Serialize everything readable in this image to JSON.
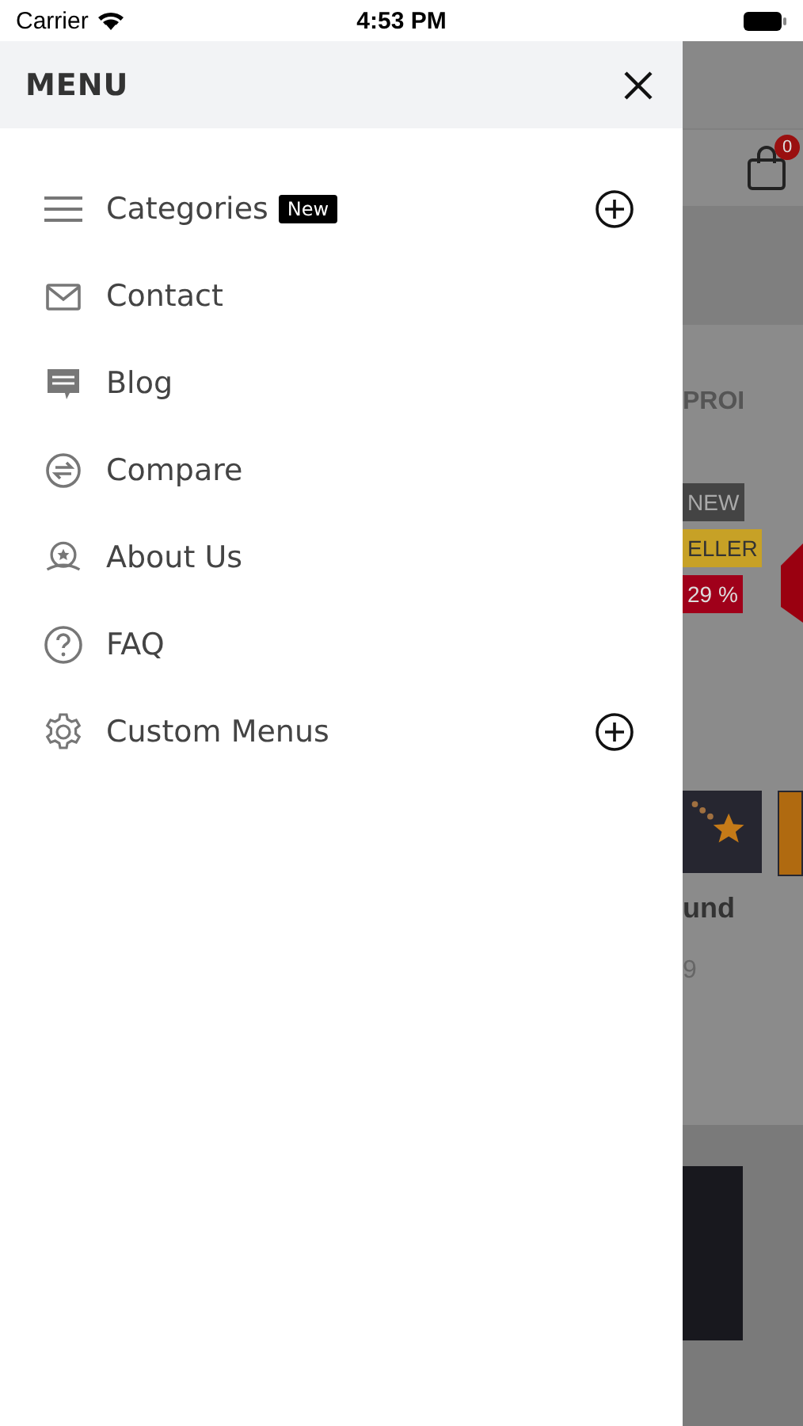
{
  "status_bar": {
    "carrier": "Carrier",
    "time": "4:53 PM"
  },
  "drawer": {
    "title": "MENU",
    "items": [
      {
        "kind": "lines",
        "label": "Categories",
        "badge": "New",
        "expandable": true
      },
      {
        "kind": "mail",
        "label": "Contact",
        "expandable": false
      },
      {
        "kind": "chat",
        "label": "Blog",
        "expandable": false
      },
      {
        "kind": "swap",
        "label": "Compare",
        "expandable": false
      },
      {
        "kind": "award",
        "label": "About Us",
        "expandable": false
      },
      {
        "kind": "help",
        "label": "FAQ",
        "expandable": false
      },
      {
        "kind": "gear",
        "label": "Custom Menus",
        "expandable": true
      }
    ]
  },
  "backdrop": {
    "cart_count": "0",
    "heading": "PROI",
    "badges": [
      {
        "label": "NEW",
        "kind": "new"
      },
      {
        "label": "ELLER",
        "kind": "seller"
      },
      {
        "label": "29 %",
        "kind": "sale"
      }
    ],
    "product_title": "und",
    "price": "9"
  }
}
